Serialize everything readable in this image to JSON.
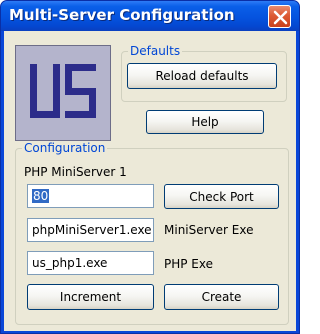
{
  "window": {
    "title": "Multi-Server Configuration"
  },
  "logo": {
    "text": "US",
    "icon": "us-logo-icon"
  },
  "defaults": {
    "label": "Defaults",
    "reload_button": "Reload defaults",
    "help_button": "Help"
  },
  "configuration": {
    "label": "Configuration",
    "server_name": "PHP MiniServer 1",
    "port": {
      "value": "80",
      "button": "Check Port"
    },
    "miniserver_exe": {
      "value": "phpMiniServer1.exe",
      "label": "MiniServer Exe"
    },
    "php_exe": {
      "value": "us_php1.exe",
      "label": "PHP Exe"
    },
    "increment_button": "Increment",
    "create_button": "Create"
  },
  "colors": {
    "titlebar": "#0553df",
    "client_bg": "#ece9d8",
    "group_label": "#0046d5",
    "selection": "#316ac5",
    "close": "#dd5a34"
  }
}
